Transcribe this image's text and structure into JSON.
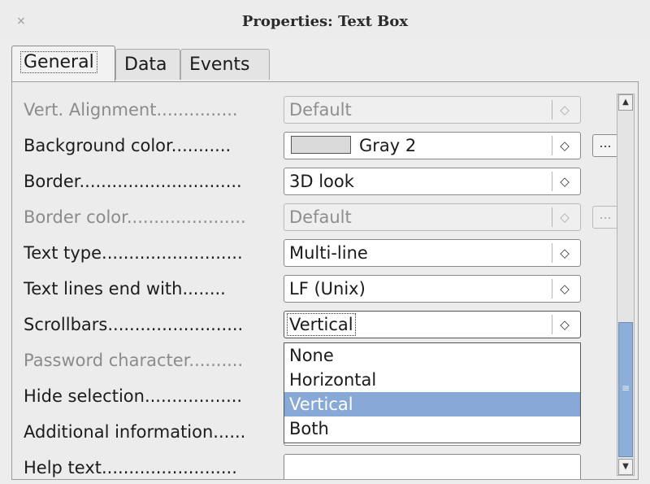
{
  "window": {
    "title": "Properties: Text Box",
    "close_glyph": "×"
  },
  "tabs": [
    {
      "label": "General",
      "active": true
    },
    {
      "label": "Data",
      "active": false
    },
    {
      "label": "Events",
      "active": false
    }
  ],
  "rows": [
    {
      "label": "Vert. Alignment...............",
      "value": "Default",
      "disabled": true
    },
    {
      "label": "Background color...........",
      "value": "Gray 2",
      "disabled": false,
      "swatch_color": "#dadada",
      "has_button": true
    },
    {
      "label": "Border..............................",
      "value": "3D look",
      "disabled": false
    },
    {
      "label": "Border color......................",
      "value": "Default",
      "disabled": true,
      "has_button": true
    },
    {
      "label": "Text type..........................",
      "value": "Multi-line",
      "disabled": false
    },
    {
      "label": "Text lines end with........",
      "value": "LF (Unix)",
      "disabled": false
    },
    {
      "label": "Scrollbars.........................",
      "value": "Vertical",
      "disabled": false,
      "active": true
    },
    {
      "label": "Password character..........",
      "value": "",
      "disabled": true
    },
    {
      "label": "Hide selection..................",
      "value": "",
      "disabled": false
    },
    {
      "label": "Additional information......",
      "value": "",
      "disabled": false
    },
    {
      "label": "Help text.........................",
      "value": "",
      "disabled": false
    }
  ],
  "dropdown": {
    "options": [
      "None",
      "Horizontal",
      "Vertical",
      "Both"
    ],
    "selected": "Vertical"
  },
  "buttons": {
    "dots_label": "..."
  },
  "icons": {
    "spin": "spin-updown-icon",
    "scroll_up": "chevron-up-icon",
    "scroll_down": "chevron-down-icon",
    "thumb_grip": "grip-icon"
  },
  "glyphs": {
    "spin": "◇",
    "scroll_up": "▲",
    "scroll_down": "▼",
    "grip": "≡"
  },
  "colors": {
    "selection": "#88a8d8",
    "scroll_thumb": "#8eaed8"
  }
}
